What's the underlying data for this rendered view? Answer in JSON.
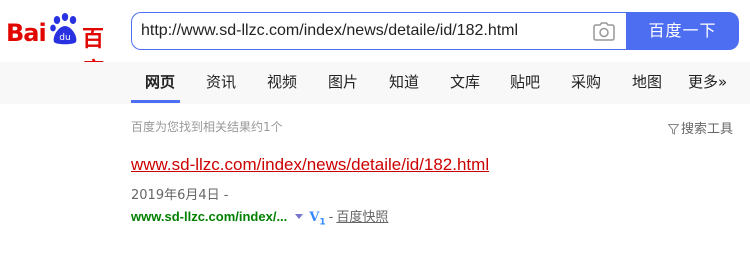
{
  "logo": {
    "text_left": "Bai",
    "text_paw": "du",
    "text_right": "百度"
  },
  "search": {
    "query": "http://www.sd-llzc.com/index/news/detaile/id/182.html",
    "button_label": "百度一下"
  },
  "nav": {
    "items": [
      {
        "label": "网页",
        "active": true
      },
      {
        "label": "资讯"
      },
      {
        "label": "视频"
      },
      {
        "label": "图片"
      },
      {
        "label": "知道"
      },
      {
        "label": "文库"
      },
      {
        "label": "贴吧"
      },
      {
        "label": "采购"
      },
      {
        "label": "地图"
      },
      {
        "label": "更多»"
      }
    ]
  },
  "results_info": {
    "count_text": "百度为您找到相关结果约1个",
    "tools_label": "搜索工具"
  },
  "results": [
    {
      "title": "www.sd-llzc.com/index/news/detaile/id/182.html",
      "date": "2019年6月4日 -",
      "display_url": "www.sd-llzc.com/index/...",
      "badge_v": "V",
      "badge_level": "1",
      "separator": "-",
      "snapshot_label": "百度快照"
    }
  ],
  "colors": {
    "accent": "#4e6ef2",
    "brand_red": "#e10602",
    "link_red": "#cc0000",
    "url_green": "#008000",
    "badge_blue": "#3388ff"
  },
  "icons": [
    "baidu-paw-icon",
    "camera-icon",
    "filter-icon",
    "url-dropdown-arrow-icon"
  ]
}
